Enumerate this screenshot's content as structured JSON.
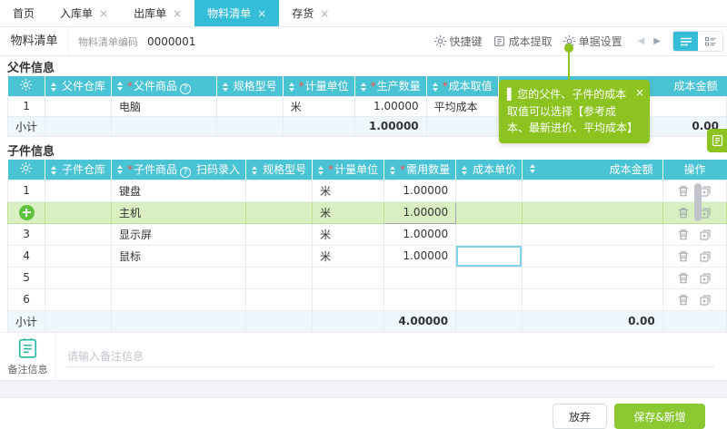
{
  "tabs": [
    {
      "label": "首页",
      "close": ""
    },
    {
      "label": "入库单",
      "close": "×"
    },
    {
      "label": "出库单",
      "close": "×"
    },
    {
      "label": "物料清单",
      "close": "×",
      "active": true
    },
    {
      "label": "存货",
      "close": "×"
    }
  ],
  "subbar": {
    "doc_tab": "物料清单",
    "code_label": "物料清单编码",
    "code_value": "0000001",
    "actions": [
      {
        "label": "快捷键"
      },
      {
        "label": "成本提取"
      },
      {
        "label": "单据设置"
      }
    ]
  },
  "icons": {
    "close": "×",
    "prev": "◀",
    "next": "▶",
    "megaphone": "▌",
    "help": "?"
  },
  "tooltip": {
    "text": "您的父件、子件的成本取值可以选择【参考成本、最新进价、平均成本】",
    "close": "×"
  },
  "colors": {
    "accent_cyan": "#35bdd8",
    "header_cyan": "#4ac3d4",
    "accent_green": "#8cc320"
  },
  "parent": {
    "title": "父件信息",
    "headers": {
      "warehouse": {
        "req": "",
        "label": "父件仓库"
      },
      "product": {
        "req": "*",
        "label": "父件商品"
      },
      "spec": {
        "req": "",
        "label": "规格型号"
      },
      "unit": {
        "req": "*",
        "label": "计量单位"
      },
      "qty": {
        "req": "*",
        "label": "生产数量"
      },
      "cost_mode": {
        "req": "*",
        "label": "成本取值"
      },
      "amount": {
        "label": "成本金额"
      }
    },
    "row": {
      "num": "1",
      "warehouse": "",
      "product": "电脑",
      "spec": "",
      "unit": "米",
      "qty": "1.00000",
      "cost_mode": "平均成本",
      "amount": ""
    },
    "subtotal": {
      "label": "小计",
      "qty": "1.00000",
      "amount": "0.00"
    }
  },
  "child": {
    "title": "子件信息",
    "scan_label": "扫码录入",
    "headers": {
      "warehouse": {
        "req": "",
        "label": "子件仓库"
      },
      "product": {
        "req": "*",
        "label": "子件商品"
      },
      "spec": {
        "req": "",
        "label": "规格型号"
      },
      "unit": {
        "req": "*",
        "label": "计量单位"
      },
      "qty": {
        "req": "*",
        "label": "需用数量"
      },
      "price": {
        "req": "",
        "label": "成本单价"
      },
      "amount": {
        "label": "成本金额"
      },
      "ops": {
        "label": "操作"
      }
    },
    "rows": [
      {
        "num": "1",
        "product": "键盘",
        "unit": "米",
        "qty": "1.00000"
      },
      {
        "num": "",
        "product": "主机",
        "unit": "米",
        "qty": "1.00000"
      },
      {
        "num": "3",
        "product": "显示屏",
        "unit": "米",
        "qty": "1.00000"
      },
      {
        "num": "4",
        "product": "鼠标",
        "unit": "米",
        "qty": "1.00000"
      },
      {
        "num": "5",
        "product": "",
        "unit": "",
        "qty": ""
      },
      {
        "num": "6",
        "product": "",
        "unit": "",
        "qty": ""
      }
    ],
    "subtotal": {
      "label": "小计",
      "qty": "4.00000",
      "amount": "0.00"
    }
  },
  "note": {
    "label": "备注信息",
    "placeholder": "请输入备注信息"
  },
  "footer": {
    "cancel": "放弃",
    "save": "保存&新增"
  }
}
